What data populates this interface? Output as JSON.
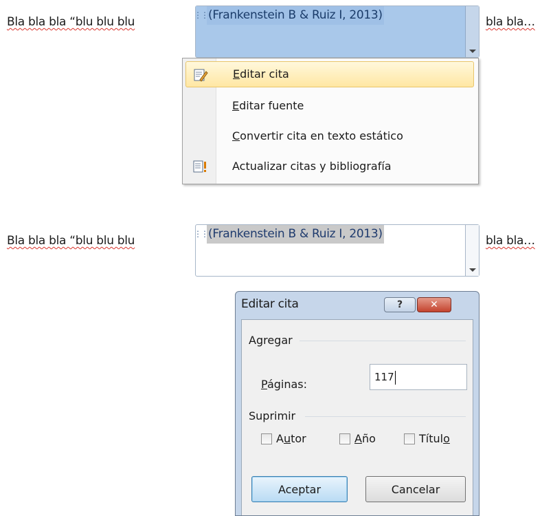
{
  "document": {
    "text_before": "Bla bla bla “blu blu blu",
    "text_after": "bla bla…",
    "citation": "(Frankenstein B & Ruiz I, 2013)"
  },
  "context_menu": {
    "items": [
      {
        "label_u": "E",
        "label_rest": "ditar cita",
        "icon": "edit-citation-icon",
        "highlighted": true
      },
      {
        "label_u": "E",
        "label_rest": "ditar fuente",
        "icon": "",
        "highlighted": false
      },
      {
        "label_u": "C",
        "label_rest": "onvertir cita en texto estático",
        "icon": "",
        "highlighted": false
      },
      {
        "label_u": "",
        "label_rest": "Actualizar citas y bibliografía",
        "icon": "update-citations-icon",
        "highlighted": false
      }
    ]
  },
  "dialog": {
    "title": "Editar cita",
    "help_label": "?",
    "close_label": "✕",
    "group_add": "Agregar",
    "pages_label_u": "P",
    "pages_label_rest": "áginas:",
    "pages_value": "117",
    "group_suppress": "Suprimir",
    "chk_author_a": "A",
    "chk_author_u": "u",
    "chk_author_rest": "tor",
    "chk_year_u": "A",
    "chk_year_rest": "ño",
    "chk_title_pre": "Títul",
    "chk_title_u": "o",
    "ok_label": "Aceptar",
    "cancel_label": "Cancelar"
  },
  "colors": {
    "selection": "#a9c8ea",
    "menu_highlight": "#ffe7a3",
    "spell_underline": "#d9332b"
  }
}
